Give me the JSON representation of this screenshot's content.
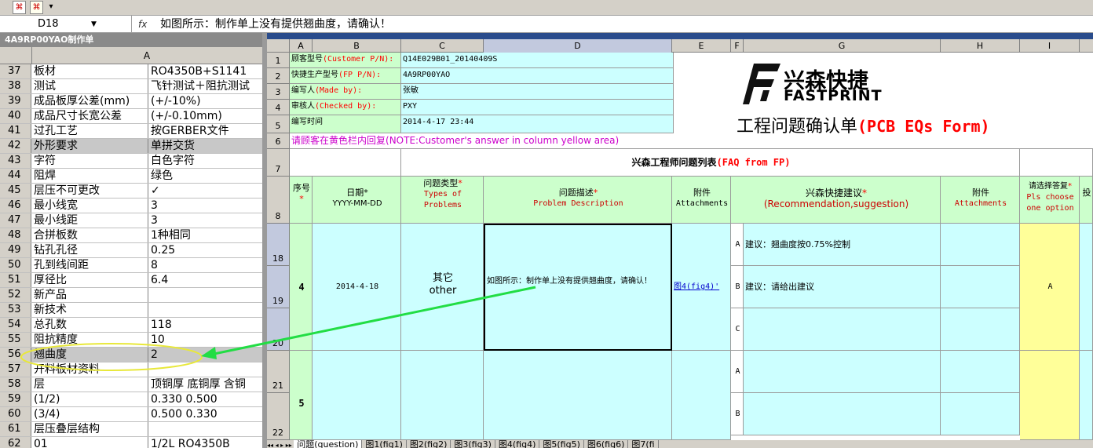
{
  "toolbar": {
    "icon1": "pdf-icon",
    "icon2": "pdf-convert-icon"
  },
  "formula_bar": {
    "name_box": "D18",
    "fx": "fx",
    "content": "如图所示：制作单上没有提供翘曲度，请确认！"
  },
  "left_pane": {
    "title": "4A9RP00YAO制作单",
    "column": "A",
    "rows": [
      {
        "n": "37",
        "a": "板材",
        "b": "RO4350B+S1141"
      },
      {
        "n": "38",
        "a": "测试",
        "b": "飞针测试＋阻抗测试"
      },
      {
        "n": "39",
        "a": "成品板厚公差(mm)",
        "b": "(+/-10%)"
      },
      {
        "n": "40",
        "a": "成品尺寸长宽公差",
        "b": "(+/-0.10mm)"
      },
      {
        "n": "41",
        "a": "过孔工艺",
        "b": "按GERBER文件"
      },
      {
        "n": "42",
        "a": "外形要求",
        "b": "单拼交货"
      },
      {
        "n": "43",
        "a": "字符",
        "b": "白色字符"
      },
      {
        "n": "44",
        "a": "阻焊",
        "b": "绿色"
      },
      {
        "n": "45",
        "a": "层压不可更改",
        "b": "✓"
      },
      {
        "n": "46",
        "a": "最小线宽",
        "b": "3"
      },
      {
        "n": "47",
        "a": "最小线距",
        "b": "3"
      },
      {
        "n": "48",
        "a": "合拼板数",
        "b": "1种相同"
      },
      {
        "n": "49",
        "a": "钻孔孔径",
        "b": "0.25"
      },
      {
        "n": "50",
        "a": "孔到线间距",
        "b": "8"
      },
      {
        "n": "51",
        "a": "厚径比",
        "b": "6.4"
      },
      {
        "n": "52",
        "a": "新产品",
        "b": ""
      },
      {
        "n": "53",
        "a": "新技术",
        "b": ""
      },
      {
        "n": "54",
        "a": "总孔数",
        "b": "118"
      },
      {
        "n": "55",
        "a": "阻抗精度",
        "b": "10"
      },
      {
        "n": "56",
        "a": "翘曲度",
        "b": "2"
      },
      {
        "n": "57",
        "a": "开料板材资料",
        "b": ""
      },
      {
        "n": "58",
        "a": "层",
        "b": "顶铜厚  底铜厚  含铜"
      },
      {
        "n": "59",
        "a": "(1/2)",
        "b": "0.330  0.500"
      },
      {
        "n": "60",
        "a": "(3/4)",
        "b": "0.500  0.330"
      },
      {
        "n": "61",
        "a": "层压叠层结构",
        "b": ""
      },
      {
        "n": "62",
        "a": "01",
        "b": "1/2L  RO4350B"
      }
    ]
  },
  "right_pane": {
    "columns": [
      "A",
      "B",
      "C",
      "D",
      "E",
      "F",
      "G",
      "H",
      "I"
    ],
    "row_numbers": [
      "1",
      "2",
      "3",
      "4",
      "5",
      "6",
      "7",
      "8",
      "18",
      "19",
      "20",
      "21",
      "22"
    ],
    "info": [
      {
        "label": "顾客型号",
        "label_en": "(Customer P/N):",
        "value": "Q14E029B01_20140409S"
      },
      {
        "label": "快捷生产型号",
        "label_en": "(FP P/N):",
        "value": "4A9RP00YAO"
      },
      {
        "label": "编写人",
        "label_en": "(Made by):",
        "value": "张敏"
      },
      {
        "label": "审核人",
        "label_en": "(Checked by):",
        "value": "PXY"
      },
      {
        "label": "编写时间",
        "label_en": "",
        "value": "2014-4-17 23:44"
      }
    ],
    "logo_cn": "兴森快捷",
    "logo_en": "FASTPRINT",
    "form_title_cn": "工程问题确认单",
    "form_title_en": "(PCB EQs Form)",
    "row6_note_cn": "请顾客在黄色栏内回复",
    "row6_note_en": "(NOTE:Customer's answer in column yellow area)",
    "faq_title_cn": "兴森工程师问题列表",
    "faq_title_en": "(FAQ from FP)",
    "headers": {
      "seq": "序号",
      "date": "日期",
      "date_fmt": "YYYY-MM-DD",
      "type": "问题类型",
      "type_en": "Types of Problems",
      "desc": "问题描述",
      "desc_en": "Problem Description",
      "att": "附件",
      "att_en": "Attachments",
      "rec": "兴森快捷建议",
      "rec_en": "(Recommendation,suggestion)",
      "att2": "附件",
      "att2_en": "Attachments",
      "reply": "请选择答复",
      "reply_en": "Pls choose one option",
      "next": "投"
    },
    "entry4": {
      "seq": "4",
      "date": "2014-4-18",
      "type_cn": "其它",
      "type_en": "other",
      "desc": "如图所示：制作单上没有提供翘曲度，请确认！",
      "attachment": "图4(fig4)'",
      "options": [
        {
          "k": "A",
          "v": "建议：翘曲度按0.75%控制"
        },
        {
          "k": "B",
          "v": "建议：请给出建议"
        },
        {
          "k": "C",
          "v": ""
        }
      ],
      "answer": "A"
    },
    "entry5": {
      "seq": "5",
      "options": [
        {
          "k": "A",
          "v": ""
        },
        {
          "k": "B",
          "v": ""
        }
      ]
    }
  },
  "sheet_tabs": [
    "问题(question)",
    "图1(fig1)",
    "图2(fig2)",
    "图3(fig3)",
    "图4(fig4)",
    "图5(fig5)",
    "图6(fig6)",
    "图7(fi"
  ],
  "colors": {
    "green": "#ccffcc",
    "cyan": "#ccffff",
    "yellow": "#ffff99",
    "red": "#ff0000",
    "arrow": "#22dd44",
    "ellipse": "#e8e83a"
  }
}
